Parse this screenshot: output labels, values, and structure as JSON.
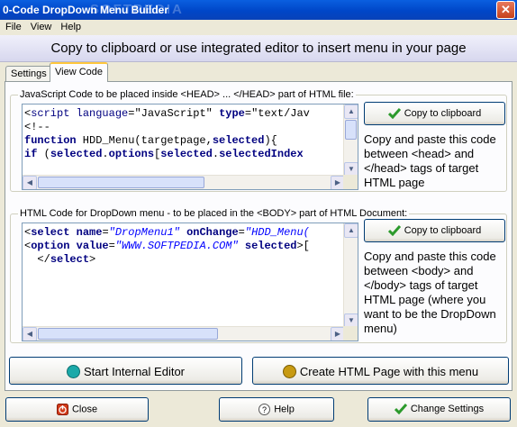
{
  "window": {
    "title": "0-Code DropDown Menu Builder",
    "watermark": "SOFTPEDIA",
    "close_glyph": "✕"
  },
  "menu": [
    "File",
    "View",
    "Help"
  ],
  "banner": "Copy to clipboard or use integrated editor to insert menu in your page",
  "tabs": [
    {
      "label": "Settings",
      "active": false
    },
    {
      "label": "View Code",
      "active": true
    }
  ],
  "head_section": {
    "label": "JavaScript Code to be placed inside <HEAD> ... </HEAD> part of HTML file:",
    "code_lines": [
      "<script language=\"JavaScript\" type=\"text/Jav",
      "<!--",
      "function HDD_Menu(targetpage,selected){",
      "if (selected.options[selected.selectedIndex"
    ],
    "copy_button": "Copy to clipboard",
    "description": "Copy and paste this code between <head> and </head> tags of target HTML page"
  },
  "body_section": {
    "label": "HTML Code for DropDown menu - to be placed in the <BODY> part of HTML Document:",
    "code_lines": [
      "<select name=\"DropMenu1\" onChange=\"HDD_Menu(",
      "<option value=\"WWW.SOFTPEDIA.COM\" selected>[",
      "  </select>"
    ],
    "copy_button": "Copy to clipboard",
    "description": "Copy and paste this code between <body> and </body> tags of target HTML page (where you want to be the DropDown menu)"
  },
  "actions": {
    "start_editor": "Start Internal Editor",
    "create_page": "Create HTML Page  with this menu"
  },
  "footer": {
    "close": "Close",
    "help": "Help",
    "change_settings": "Change Settings"
  }
}
